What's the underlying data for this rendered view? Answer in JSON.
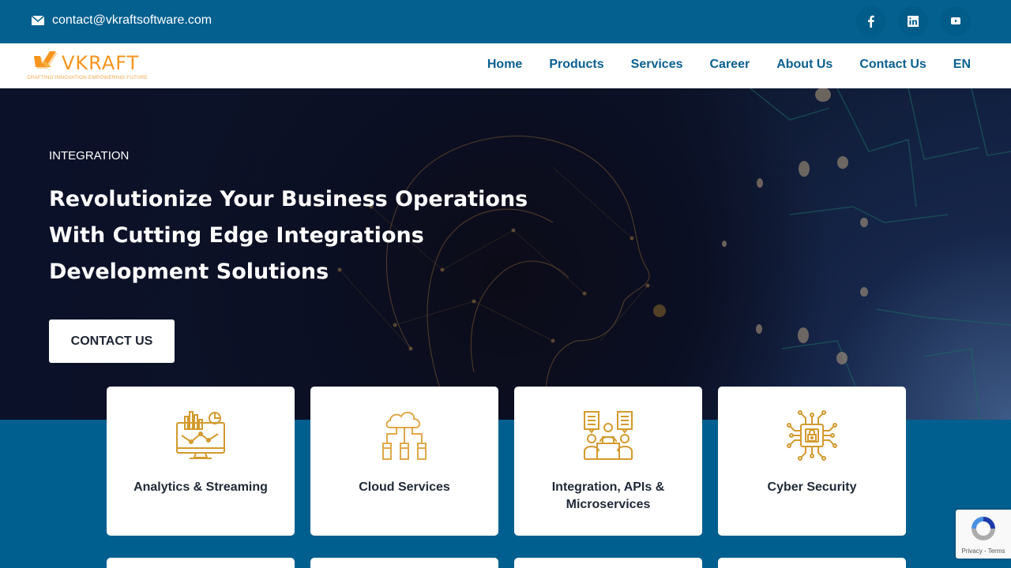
{
  "topbar": {
    "email": "contact@vkraftsoftware.com",
    "social": [
      {
        "name": "facebook-icon",
        "glyph": "f"
      },
      {
        "name": "linkedin-icon",
        "glyph": "in"
      },
      {
        "name": "youtube-icon",
        "glyph": "play"
      }
    ]
  },
  "brand": {
    "name": "VKRAFT",
    "tagline": "CRAFTING INNOVATION EMPOWERING FUTURE",
    "color": "#f7941d"
  },
  "nav": {
    "items": [
      "Home",
      "Products",
      "Services",
      "Career",
      "About Us",
      "Contact Us",
      "EN"
    ]
  },
  "hero": {
    "eyebrow": "INTEGRATION",
    "headline": [
      "Revolutionize Your Business Operations",
      "With Cutting Edge Integrations",
      "Development Solutions"
    ],
    "cta": "CONTACT US"
  },
  "services": [
    {
      "title": "Analytics & Streaming",
      "icon": "analytics-monitor-icon"
    },
    {
      "title": "Cloud Services",
      "icon": "cloud-network-icon"
    },
    {
      "title": "Integration, APIs & Microservices",
      "icon": "team-meeting-icon"
    },
    {
      "title": "Cyber Security",
      "icon": "security-chip-icon"
    }
  ],
  "recaptcha": {
    "links": "Privacy - Terms"
  },
  "colors": {
    "primary": "#03608f",
    "accent": "#d39a2e",
    "nav_text": "#0a5f91"
  }
}
